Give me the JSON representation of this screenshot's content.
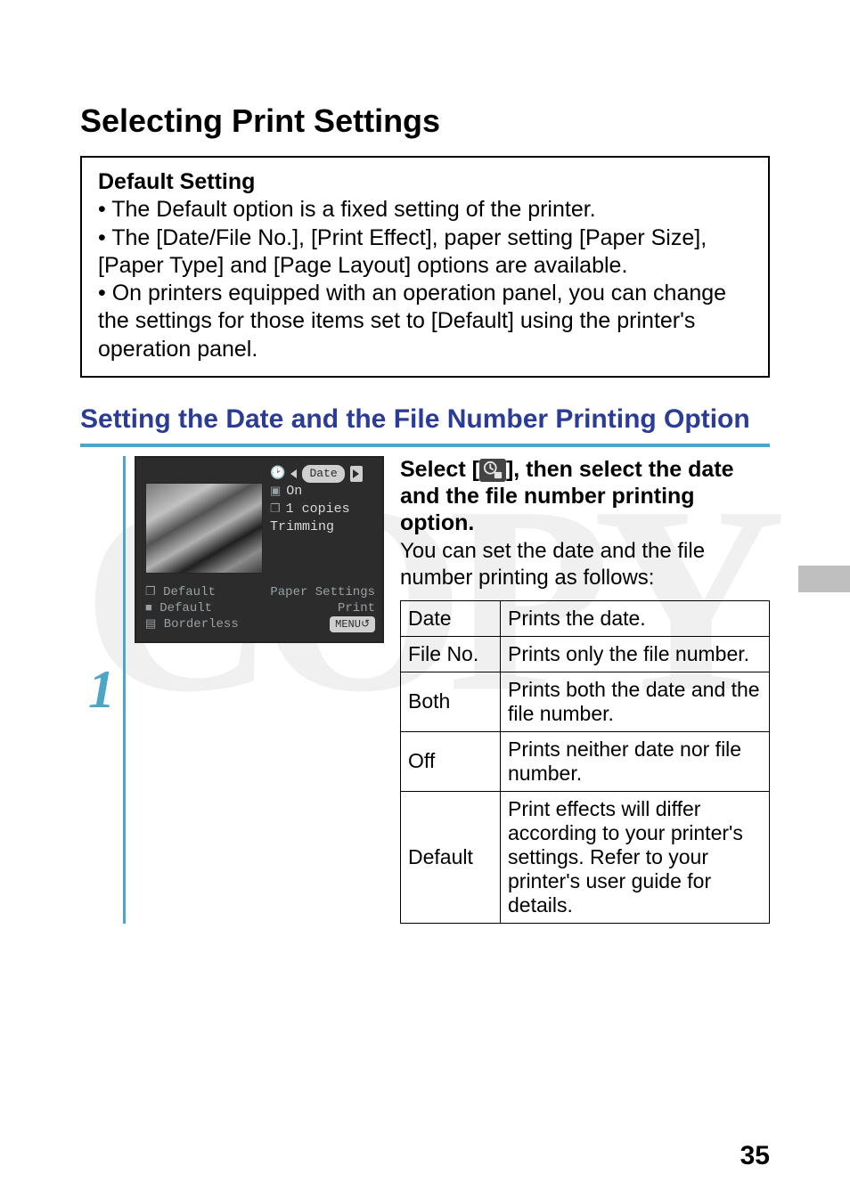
{
  "watermark": "COPY",
  "page_number": "35",
  "title": "Selecting Print Settings",
  "default_box": {
    "heading": "Default Setting",
    "bullets": [
      "The Default option is a fixed setting of the printer.",
      "The [Date/File No.], [Print Effect], paper setting [Paper Size], [Paper Type] and [Page Layout] options are available.",
      "On printers equipped with an operation panel, you can change the settings for those items set to [Default] using the printer's operation panel."
    ]
  },
  "subsection": "Setting the Date and the File Number Printing Option",
  "step": {
    "number": "1",
    "screenshot": {
      "menu": {
        "row1": "Date",
        "row2_label": "On",
        "row3_label": "1 copies",
        "row4_label": "Trimming"
      },
      "bottom": {
        "r1l": "Default",
        "r1r": "Paper Settings",
        "r2l": "Default",
        "r2r": "Print",
        "r3l": "Borderless",
        "menu_btn": "MENU"
      }
    },
    "instruction_pre": "Select [",
    "instruction_post": "], then select the date and the file number printing option.",
    "description": "You can set the date and the file number printing as follows:",
    "table": [
      {
        "k": "Date",
        "v": "Prints the date."
      },
      {
        "k": "File No.",
        "v": "Prints only the file number."
      },
      {
        "k": "Both",
        "v": "Prints both the date and the file number."
      },
      {
        "k": "Off",
        "v": "Prints neither date nor file number."
      },
      {
        "k": "Default",
        "v": "Print effects will differ according to your printer's settings. Refer to your printer's user guide for details."
      }
    ]
  }
}
